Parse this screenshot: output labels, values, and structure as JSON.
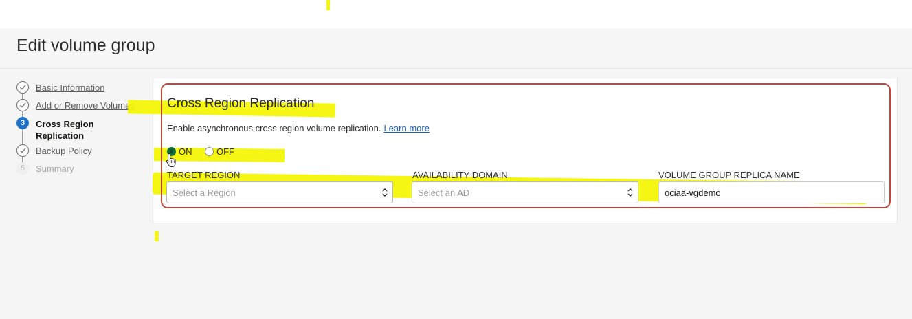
{
  "page": {
    "title": "Edit volume group"
  },
  "steps": [
    {
      "number": "1",
      "label": "Basic Information",
      "state": "done"
    },
    {
      "number": "2",
      "label": "Add or Remove Volumes",
      "state": "done"
    },
    {
      "number": "3",
      "label": "Cross Region Replication",
      "state": "current"
    },
    {
      "number": "4",
      "label": "Backup Policy",
      "state": "done"
    },
    {
      "number": "5",
      "label": "Summary",
      "state": "upcoming"
    }
  ],
  "section": {
    "title": "Cross Region Replication",
    "description": "Enable asynchronous cross region volume replication.",
    "learn_more": "Learn more"
  },
  "replication_toggle": {
    "on_label": "ON",
    "off_label": "OFF",
    "selected": "ON"
  },
  "fields": {
    "target_region": {
      "label": "TARGET REGION",
      "placeholder": "Select a Region",
      "value": ""
    },
    "availability_domain": {
      "label": "AVAILABILITY DOMAIN",
      "placeholder": "Select an AD",
      "value": ""
    },
    "replica_name": {
      "label": "VOLUME GROUP REPLICA NAME",
      "value": "ociaa-vgdemo"
    }
  },
  "colors": {
    "accent": "#1f72c8",
    "highlight": "#f4f500",
    "callout_border": "#c0473a",
    "radio_selected": "#0f6b3a"
  }
}
